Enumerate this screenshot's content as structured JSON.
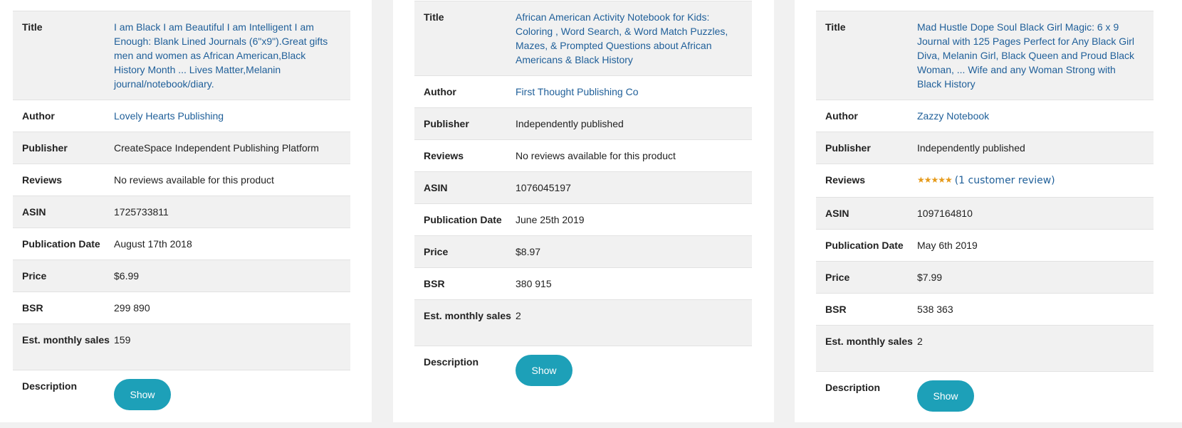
{
  "labels": {
    "title": "Title",
    "author": "Author",
    "publisher": "Publisher",
    "reviews": "Reviews",
    "asin": "ASIN",
    "publication_date": "Publication Date",
    "price": "Price",
    "bsr": "BSR",
    "est_monthly_sales": "Est. monthly sales",
    "description": "Description",
    "show_button": "Show"
  },
  "books": [
    {
      "title": "I am Black I am Beautiful I am Intelligent I am Enough: Blank Lined Journals (6\"x9\").Great gifts men and women as African American,Black History Month ... Lives Matter,Melanin journal/notebook/diary.",
      "author": "Lovely Hearts Publishing",
      "publisher": "CreateSpace Independent Publishing Platform",
      "reviews": "No reviews available for this product",
      "asin": "1725733811",
      "publication_date": "August 17th 2018",
      "price": "$6.99",
      "bsr": "299 890",
      "est_monthly_sales": "159"
    },
    {
      "title": "African American Activity Notebook for Kids: Coloring , Word Search, & Word Match Puzzles, Mazes, & Prompted Questions about African Americans & Black History",
      "author": "First Thought Publishing Co",
      "publisher": "Independently published",
      "reviews": "No reviews available for this product",
      "asin": "1076045197",
      "publication_date": "June 25th 2019",
      "price": "$8.97",
      "bsr": "380 915",
      "est_monthly_sales": "2"
    },
    {
      "title": "Mad Hustle Dope Soul Black Girl Magic: 6 x 9 Journal with 125 Pages Perfect for Any Black Girl Diva, Melanin Girl, Black Queen and Proud Black Woman, ... Wife and any Woman Strong with Black History",
      "author": "Zazzy Notebook",
      "publisher": "Independently published",
      "reviews_stars": "★★★★★",
      "reviews_link": "(1 customer review)",
      "rating": 5,
      "asin": "1097164810",
      "publication_date": "May 6th 2019",
      "price": "$7.99",
      "bsr": "538 363",
      "est_monthly_sales": "2"
    }
  ],
  "colors": {
    "link": "#1f5f99",
    "button": "#1da0b8",
    "row_shade": "#f1f1f1",
    "stars": "#e69a1a"
  }
}
